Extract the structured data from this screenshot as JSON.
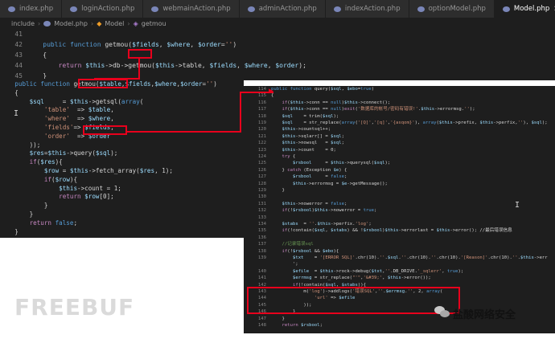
{
  "tabs": [
    "index.php",
    "loginAction.php",
    "webmainAction.php",
    "adminAction.php",
    "indexAction.php",
    "optionModel.php",
    "Model.php"
  ],
  "active_tab_index": 6,
  "close_glyph": "×",
  "breadcrumb": [
    "include",
    "Model.php",
    "Model",
    "getmou"
  ],
  "top_editor": {
    "lines": [
      {
        "n": "41",
        "t": ""
      },
      {
        "n": "42",
        "t": "public function getmou($fields, $where, $order='')"
      },
      {
        "n": "43",
        "t": "{"
      },
      {
        "n": "44",
        "t": "return $this->db->getmou($this->table, $fields, $where, $order);"
      },
      {
        "n": "45",
        "t": "}"
      }
    ]
  },
  "left_editor": {
    "lines": [
      "public function getmou($table,$fields,$where,$order='')",
      "{",
      "    $sql     = $this->getsql(array(",
      "        'table'  => $table,",
      "        'where'  => $where,",
      "        'fields'=> $fields,",
      "        'order'  => $order",
      "    ));",
      "    $res=$this->query($sql);",
      "    if($res){",
      "        $row = $this->fetch_array($res, 1);",
      "        if($row){",
      "            $this->count = 1;",
      "            return $row[0];",
      "        }",
      "    }",
      "    return false;",
      "}"
    ]
  },
  "right_editor": {
    "lines": [
      {
        "n": "114",
        "t": "public function query($sql, $ebo=true)"
      },
      {
        "n": "115",
        "t": "{"
      },
      {
        "n": "116",
        "t": "    if($this->conn == null)$this->connect();"
      },
      {
        "n": "117",
        "t": "    if($this->conn == null)exit('数据库的帐号/密码有错误!'.$this->errormsg.'');"
      },
      {
        "n": "118",
        "t": "    $sql    = trim($sql);"
      },
      {
        "n": "119",
        "t": "    $sql    = str_replace(array('[Q]','[q]','{asqom}'), array($this->prefix, $this->perfix,''), $sql);"
      },
      {
        "n": "120",
        "t": "    $this->countsql++;"
      },
      {
        "n": "121",
        "t": "    $this->sqlarr[] = $sql;"
      },
      {
        "n": "122",
        "t": "    $this->nowsql   = $sql;"
      },
      {
        "n": "123",
        "t": "    $this->count    = 0;"
      },
      {
        "n": "124",
        "t": "    try {"
      },
      {
        "n": "125",
        "t": "        $rsbool     = $this->querysql($sql);"
      },
      {
        "n": "126",
        "t": "    } catch (Exception $e) {"
      },
      {
        "n": "127",
        "t": "        $rsbool     = false;"
      },
      {
        "n": "128",
        "t": "        $this->errormsg = $e->getMessage();"
      },
      {
        "n": "129",
        "t": "    }"
      },
      {
        "n": "130",
        "t": ""
      },
      {
        "n": "131",
        "t": "    $this->nowerror = false;"
      },
      {
        "n": "132",
        "t": "    if(!$rsbool)$this->nowerror = true;"
      },
      {
        "n": "133",
        "t": ""
      },
      {
        "n": "134",
        "t": "    $stabs  = ''.$this->perfix.'log';"
      },
      {
        "n": "135",
        "t": "    if(!contain($sql, $stabs) && !$rsbool)$this->errorlast = $this->error(); //最后错误信息"
      },
      {
        "n": "136",
        "t": ""
      },
      {
        "n": "137",
        "t": "    //记录错误sql"
      },
      {
        "n": "138",
        "t": "    if(!$rsbool && $ebo){"
      },
      {
        "n": "139",
        "t": "        $txt    = '[ERROR SQL]'.chr(10).''.$sql.''.chr(10).''.chr(10).'[Reason]'.chr(10).''.$this->err"
      },
      {
        "n": "",
        "t": "        ';"
      },
      {
        "n": "140",
        "t": "        $efile  = $this->rock->debug($txt,''.DB_DRIVE.'_sqlerr', true);"
      },
      {
        "n": "141",
        "t": "        $errmsg = str_replace(\"'\",'&#39;', $this->error());"
      },
      {
        "n": "142",
        "t": "        if(!contain($sql, $stabs)){"
      },
      {
        "n": "143",
        "t": "            m('log')->addlogs('错误SQL',''.$errmsg.'', 2, array("
      },
      {
        "n": "144",
        "t": "                'url' => $efile"
      },
      {
        "n": "145",
        "t": "            ));"
      },
      {
        "n": "146",
        "t": "        }"
      },
      {
        "n": "147",
        "t": "    }"
      },
      {
        "n": "148",
        "t": "    return $rsbool;"
      }
    ]
  },
  "watermark_left": "FREEBUF",
  "watermark_right": "盐酸网络安全",
  "colors": {
    "red": "#e8001c",
    "editor_bg": "#1e1e1e"
  }
}
